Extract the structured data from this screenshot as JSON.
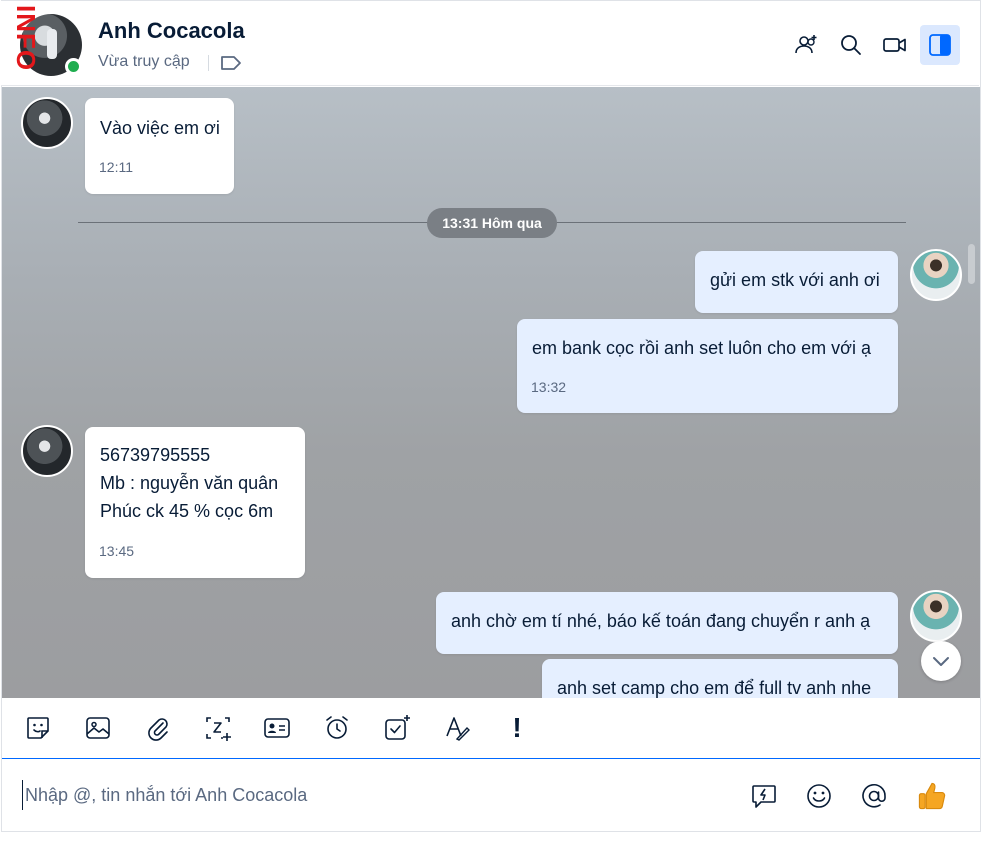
{
  "header": {
    "stamp_text": "INFO",
    "name": "Anh Cocacola",
    "status": "Vừa truy cập"
  },
  "chat": {
    "date_divider": "13:31 Hôm qua",
    "messages": [
      {
        "dir": "in",
        "lines": [
          "Vào việc em ơi"
        ],
        "time": "12:11"
      },
      {
        "dir": "out",
        "lines": [
          "gửi em stk với anh ơi"
        ]
      },
      {
        "dir": "out",
        "lines": [
          "em bank cọc rồi anh set luôn cho em với ạ"
        ],
        "time": "13:32"
      },
      {
        "dir": "in",
        "lines": [
          "56739795555",
          "Mb : nguyễn văn quân",
          "Phúc ck 45 % cọc 6m"
        ],
        "time": "13:45"
      },
      {
        "dir": "out",
        "lines": [
          "anh chờ em tí nhé, báo kế toán đang chuyển r anh ạ"
        ]
      },
      {
        "dir": "out",
        "lines": [
          "anh set camp cho em để full tv anh nhe"
        ]
      }
    ]
  },
  "toolbar": {
    "icons": [
      "sticker-icon",
      "image-icon",
      "attachment-icon",
      "screenshot-icon",
      "contact-card-icon",
      "reminder-icon",
      "todo-icon",
      "format-text-icon",
      "urgent-icon"
    ],
    "urgent_label": "!"
  },
  "composer": {
    "placeholder": "Nhập @, tin nhắn tới Anh Cocacola"
  },
  "colors": {
    "accent": "#0068ff",
    "outgoing_bubble": "#e5efff",
    "online": "#1fad4f",
    "stamp": "#e3171b",
    "like": "#f5a623"
  }
}
